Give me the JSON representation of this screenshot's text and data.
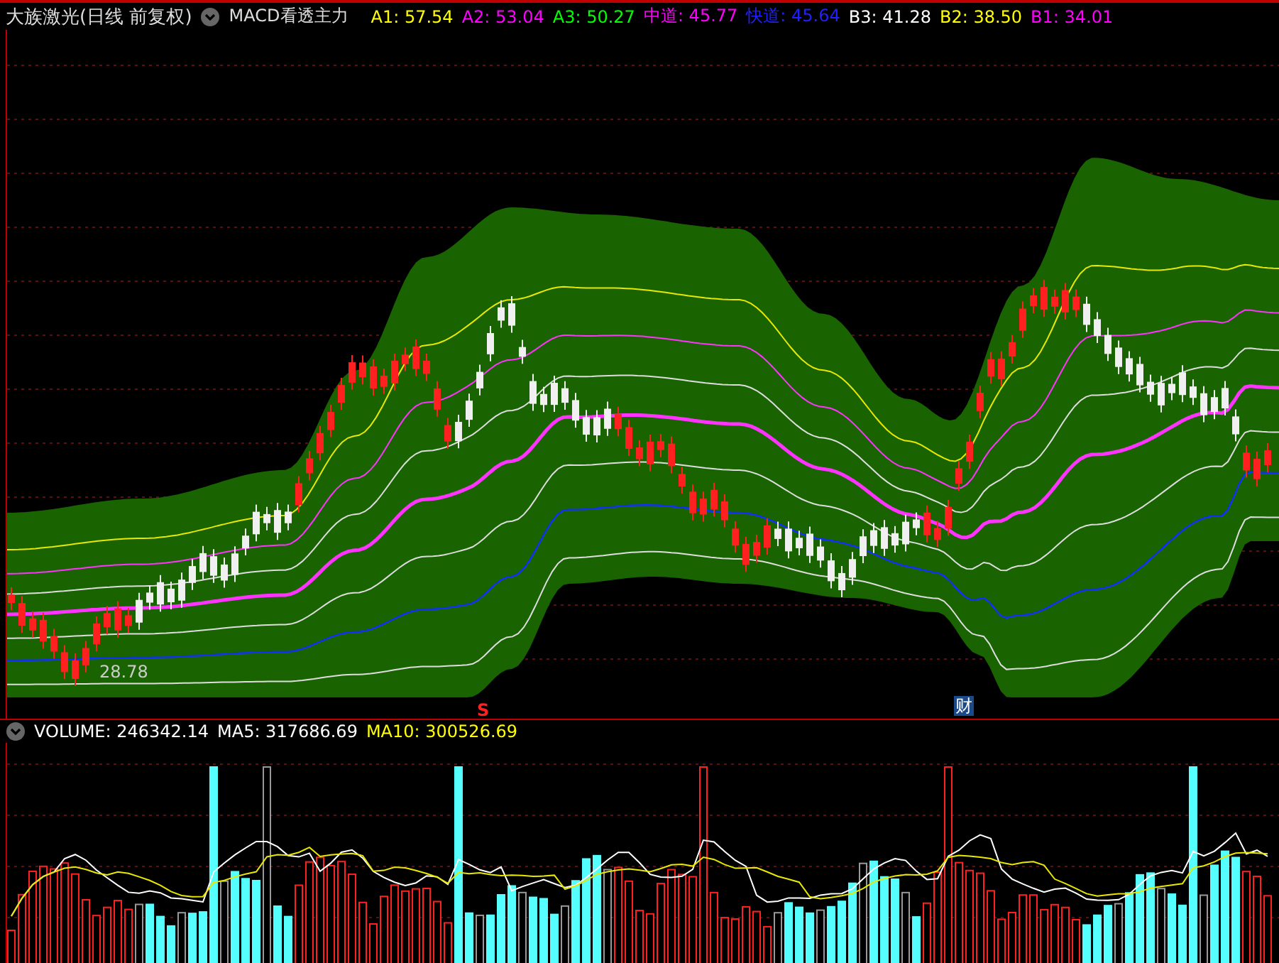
{
  "header": {
    "title": "大族激光(日线 前复权)",
    "indicator": "MACD看透主力",
    "values": [
      {
        "text": "A1: 57.54",
        "color": "#ffff00"
      },
      {
        "text": "A2: 53.04",
        "color": "#ff00ff"
      },
      {
        "text": "A3: 50.27",
        "color": "#00ff00"
      },
      {
        "text": "中道: 45.77",
        "color": "#ff00ff"
      },
      {
        "text": "快道: 45.64",
        "color": "#2020ff"
      },
      {
        "text": "B3: 41.28",
        "color": "#ffffff"
      },
      {
        "text": "B2: 38.50",
        "color": "#ffff00"
      },
      {
        "text": "B1: 34.01",
        "color": "#ff00ff"
      }
    ]
  },
  "price_chart": {
    "low_label": "28.78",
    "markers": [
      {
        "kind": "signal",
        "text": "S"
      },
      {
        "kind": "news",
        "text": "财"
      }
    ]
  },
  "volume": {
    "values": [
      {
        "text": "VOLUME: 246342.14",
        "color": "#ffffff"
      },
      {
        "text": "MA5: 317686.69",
        "color": "#ffffff"
      },
      {
        "text": "MA10: 300526.69",
        "color": "#ffff00"
      }
    ]
  }
}
